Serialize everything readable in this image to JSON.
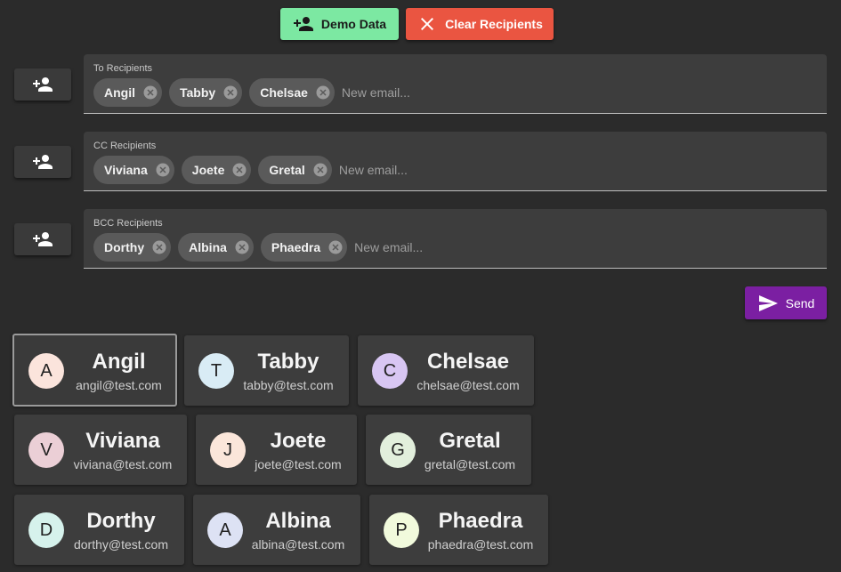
{
  "toolbar": {
    "demo_label": "Demo Data",
    "clear_label": "Clear Recipients"
  },
  "fields": {
    "to": {
      "label": "To Recipients",
      "chips": [
        "Angil",
        "Tabby",
        "Chelsae"
      ],
      "placeholder": "New email..."
    },
    "cc": {
      "label": "CC Recipients",
      "chips": [
        "Viviana",
        "Joete",
        "Gretal"
      ],
      "placeholder": "New email..."
    },
    "bcc": {
      "label": "BCC Recipients",
      "chips": [
        "Dorthy",
        "Albina",
        "Phaedra"
      ],
      "placeholder": "New email..."
    }
  },
  "send_label": "Send",
  "contacts": [
    {
      "initial": "A",
      "name": "Angil",
      "email": "angil@test.com",
      "color": "#fbe4dc",
      "selected": true
    },
    {
      "initial": "T",
      "name": "Tabby",
      "email": "tabby@test.com",
      "color": "#d9ecf5"
    },
    {
      "initial": "C",
      "name": "Chelsae",
      "email": "chelsae@test.com",
      "color": "#d8c6f3"
    },
    {
      "initial": "V",
      "name": "Viviana",
      "email": "viviana@test.com",
      "color": "#ebcfd6"
    },
    {
      "initial": "J",
      "name": "Joete",
      "email": "joete@test.com",
      "color": "#fbe6da"
    },
    {
      "initial": "G",
      "name": "Gretal",
      "email": "gretal@test.com",
      "color": "#e2efdc"
    },
    {
      "initial": "D",
      "name": "Dorthy",
      "email": "dorthy@test.com",
      "color": "#d6f2ec"
    },
    {
      "initial": "A",
      "name": "Albina",
      "email": "albina@test.com",
      "color": "#dde2f4"
    },
    {
      "initial": "P",
      "name": "Phaedra",
      "email": "phaedra@test.com",
      "color": "#f1fadc"
    }
  ],
  "colors": {
    "demo": "#7ce8a2",
    "clear": "#ea5541",
    "send": "#7b1fa2",
    "background": "#2b2b2b"
  },
  "icons": {
    "demo": "person-add-icon",
    "clear": "close-icon",
    "add": "person-add-icon",
    "chip_remove": "cancel-circle-icon",
    "send": "send-icon"
  }
}
